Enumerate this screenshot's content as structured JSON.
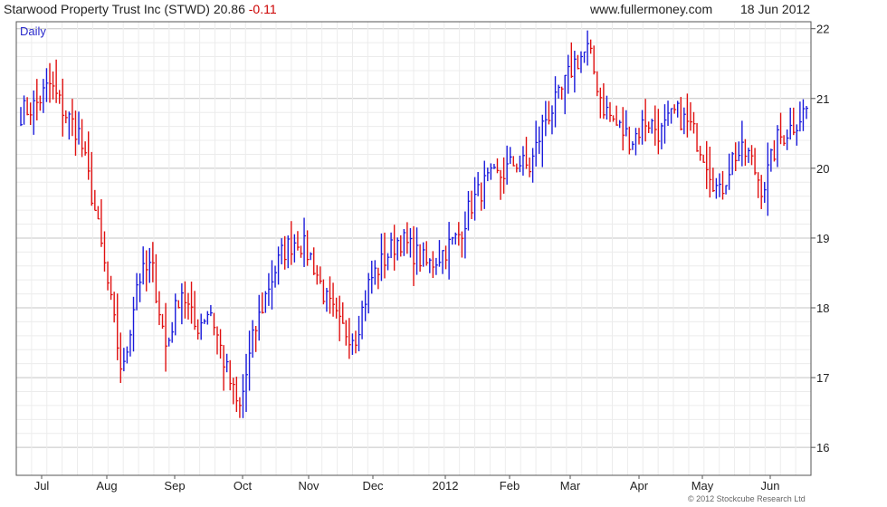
{
  "header": {
    "title": "Starwood Property Trust Inc (STWD) 20.86",
    "change": "-0.11",
    "site": "www.fullermoney.com",
    "date": "18 Jun 2012"
  },
  "footer": {
    "copyright": "© 2012 Stockcube Research Ltd"
  },
  "colors": {
    "up": "#1a1adb",
    "down": "#e01010",
    "grid": "#d8d8d8",
    "frame": "#555555",
    "period_label": "#2a2acc"
  },
  "chart_data": {
    "type": "bar",
    "period": "Daily",
    "xlabel": "",
    "ylabel": "",
    "ylim": [
      15.6,
      22.1
    ],
    "y_ticks": [
      16,
      17,
      18,
      19,
      20,
      21,
      22
    ],
    "x_ticks": [
      "Jul",
      "Aug",
      "Sep",
      "Oct",
      "Nov",
      "Dec",
      "2012",
      "Feb",
      "Mar",
      "Apr",
      "May",
      "Jun"
    ],
    "grid": true,
    "bar_style": "daily high-low range bars, blue = up day, red = down day",
    "anchors": [
      [
        "Jul",
        20.8
      ],
      [
        "Jul",
        20.9
      ],
      [
        "Jul",
        21.2
      ],
      [
        "Jul",
        20.8
      ],
      [
        "Jul",
        20.5
      ],
      [
        "Aug",
        19.5
      ],
      [
        "Aug",
        18.3
      ],
      [
        "Aug",
        17.0
      ],
      [
        "Aug",
        18.4
      ],
      [
        "Aug",
        18.6
      ],
      [
        "Sep",
        17.4
      ],
      [
        "Sep",
        18.3
      ],
      [
        "Sep",
        17.7
      ],
      [
        "Sep",
        18.0
      ],
      [
        "Sep",
        17.2
      ],
      [
        "Oct",
        16.5
      ],
      [
        "Oct",
        17.6
      ],
      [
        "Oct",
        18.3
      ],
      [
        "Oct",
        18.8
      ],
      [
        "Oct",
        19.0
      ],
      [
        "Nov",
        18.7
      ],
      [
        "Nov",
        18.1
      ],
      [
        "Nov",
        17.7
      ],
      [
        "Nov",
        17.6
      ],
      [
        "Nov",
        18.4
      ],
      [
        "Dec",
        18.7
      ],
      [
        "Dec",
        19.0
      ],
      [
        "Dec",
        18.8
      ],
      [
        "2012",
        18.6
      ],
      [
        "2012",
        18.8
      ],
      [
        "2012",
        19.0
      ],
      [
        "Feb",
        19.5
      ],
      [
        "Feb",
        19.8
      ],
      [
        "Feb",
        19.9
      ],
      [
        "Feb",
        20.1
      ],
      [
        "Mar",
        20.0
      ],
      [
        "Mar",
        20.7
      ],
      [
        "Mar",
        21.0
      ],
      [
        "Mar",
        21.5
      ],
      [
        "Mar",
        21.7
      ],
      [
        "Apr",
        20.9
      ],
      [
        "Apr",
        20.6
      ],
      [
        "Apr",
        20.4
      ],
      [
        "Apr",
        20.7
      ],
      [
        "May",
        20.5
      ],
      [
        "May",
        20.8
      ],
      [
        "May",
        20.6
      ],
      [
        "May",
        20.2
      ],
      [
        "May",
        19.6
      ],
      [
        "May",
        20.2
      ],
      [
        "Jun",
        20.2
      ],
      [
        "Jun",
        19.7
      ],
      [
        "Jun",
        20.4
      ],
      [
        "Jun",
        20.6
      ],
      [
        "Jun",
        20.86
      ]
    ]
  }
}
